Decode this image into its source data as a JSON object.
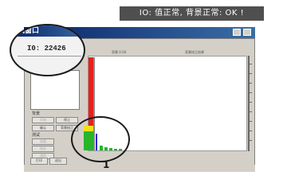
{
  "banner": {
    "text": "IO: 值正常, 背景正常: OK !"
  },
  "window": {
    "title_partial": "试窗口",
    "id_label": "I0: 22426"
  },
  "chart": {
    "left_label": "背景 0.00",
    "right_label": "背景校正结果"
  },
  "panel": {
    "group_bg": "背景",
    "group_test": "测试",
    "buttons": [
      "开始",
      "停止",
      "确认",
      "背景校正",
      "测量",
      "保存",
      "清除",
      "结果",
      "打印",
      "退出"
    ],
    "bottom_buttons": [
      "打印",
      "退出"
    ]
  },
  "callout": {
    "marker": "1"
  },
  "colors": {
    "bar_red": "#e8201a",
    "bar_yellow": "#f2e21a",
    "bar_green": "#27b52b",
    "bar_blue": "#1a2bd6",
    "titlebar": "#0a246a"
  }
}
